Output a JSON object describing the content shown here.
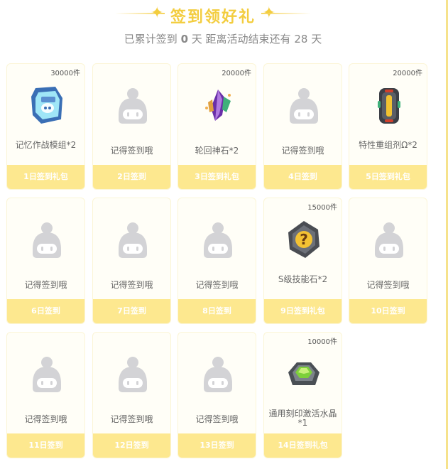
{
  "header": {
    "title": "签到领好礼",
    "subtitle_prefix": "已累计签到",
    "signed_days": "0",
    "subtitle_mid": "天  距离活动结束还有",
    "days_left": "28",
    "subtitle_suffix": "天"
  },
  "colors": {
    "accent": "#f3cd3f",
    "footer": "#fde88f",
    "card_bg": "#fffef7"
  },
  "cards": [
    {
      "count": "30000件",
      "name": "记忆作战模组*2",
      "label": "1日签到礼包",
      "icon": "memory-module-icon"
    },
    {
      "count": "",
      "name": "记得签到哦",
      "label": "2日签到",
      "icon": "placeholder-mascot-icon"
    },
    {
      "count": "20000件",
      "name": "轮回神石*2",
      "label": "3日签到礼包",
      "icon": "reincarnation-stone-icon"
    },
    {
      "count": "",
      "name": "记得签到哦",
      "label": "4日签到",
      "icon": "placeholder-mascot-icon"
    },
    {
      "count": "20000件",
      "name": "特性重组剂Ω*2",
      "label": "5日签到礼包",
      "icon": "trait-reagent-icon"
    },
    {
      "count": "",
      "name": "记得签到哦",
      "label": "6日签到",
      "icon": "placeholder-mascot-icon"
    },
    {
      "count": "",
      "name": "记得签到哦",
      "label": "7日签到",
      "icon": "placeholder-mascot-icon"
    },
    {
      "count": "",
      "name": "记得签到哦",
      "label": "8日签到",
      "icon": "placeholder-mascot-icon"
    },
    {
      "count": "15000件",
      "name": "S级技能石*2",
      "label": "9日签到礼包",
      "icon": "skill-stone-icon"
    },
    {
      "count": "",
      "name": "记得签到哦",
      "label": "10日签到",
      "icon": "placeholder-mascot-icon"
    },
    {
      "count": "",
      "name": "记得签到哦",
      "label": "11日签到",
      "icon": "placeholder-mascot-icon"
    },
    {
      "count": "",
      "name": "记得签到哦",
      "label": "12日签到",
      "icon": "placeholder-mascot-icon"
    },
    {
      "count": "",
      "name": "记得签到哦",
      "label": "13日签到",
      "icon": "placeholder-mascot-icon"
    },
    {
      "count": "10000件",
      "name": "通用刻印激活水晶*1",
      "label": "14日签到礼包",
      "icon": "engraving-crystal-icon"
    }
  ]
}
